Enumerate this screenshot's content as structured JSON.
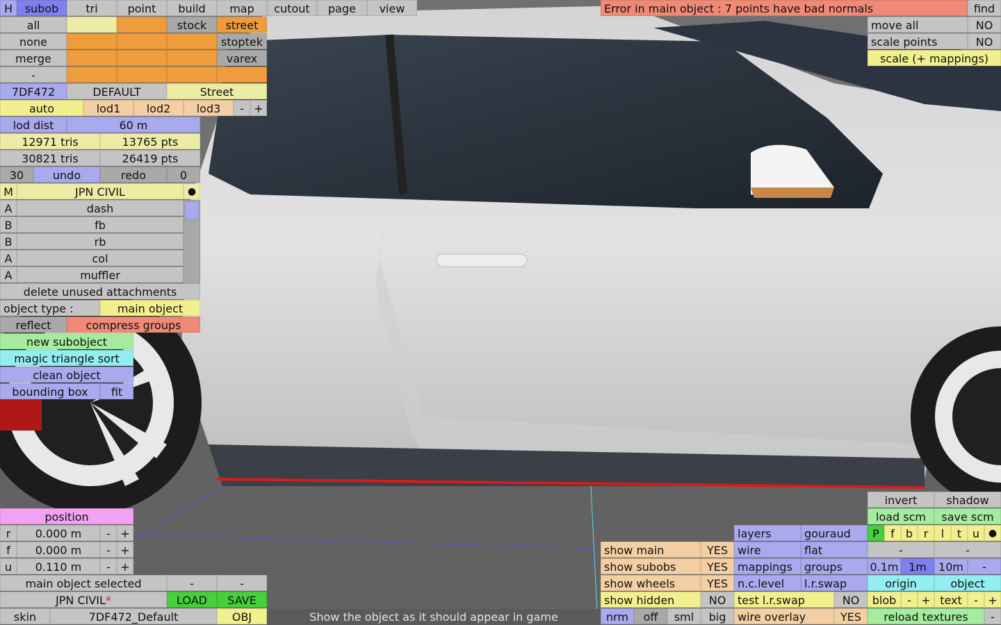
{
  "menu": {
    "h": "H",
    "items": [
      "subob",
      "tri",
      "point",
      "build",
      "map",
      "cutout",
      "page",
      "view"
    ]
  },
  "top_right": {
    "error": "Error in main object : 7 points have bad normals",
    "find": "find",
    "move_all": "move all",
    "move_all_val": "NO",
    "scale_points": "scale points",
    "scale_points_val": "NO",
    "scale_mappings": "scale (+ mappings)"
  },
  "sel": {
    "all": "all",
    "none": "none",
    "merge": "merge",
    "dash": "-"
  },
  "modes": {
    "stock": "stock",
    "street": "street",
    "stoptek": "stoptek",
    "varex": "varex"
  },
  "paint": {
    "code": "7DF472",
    "default": "DEFAULT",
    "street": "Street"
  },
  "lod": {
    "auto": "auto",
    "lod1": "lod1",
    "lod2": "lod2",
    "lod3": "lod3",
    "minus": "-",
    "plus": "+",
    "dist_label": "lod dist",
    "dist_value": "60 m"
  },
  "stats": {
    "tris1": "12971 tris",
    "pts1": "13765 pts",
    "tris2": "30821 tris",
    "pts2": "26419 pts"
  },
  "undo": {
    "count": "30",
    "undo": "undo",
    "redo": "redo",
    "redo_count": "0"
  },
  "model": {
    "m": "M",
    "name": "JPN CIVIL",
    "dot": "●"
  },
  "subobjects": [
    {
      "tag": "A",
      "name": "dash"
    },
    {
      "tag": "B",
      "name": "fb"
    },
    {
      "tag": "B",
      "name": "rb"
    },
    {
      "tag": "A",
      "name": "col"
    },
    {
      "tag": "A",
      "name": "muffler"
    }
  ],
  "actions": {
    "delete_unused": "delete unused attachments",
    "obj_type_label": "object type :",
    "obj_type_value": "main object",
    "reflect": "reflect",
    "compress": "compress groups",
    "new_sub": "new subobject",
    "magic": "magic triangle sort",
    "clean": "clean object",
    "bbox": "bounding box",
    "fit": "fit"
  },
  "position": {
    "title": "position",
    "rows": [
      {
        "axis": "r",
        "value": "0.000 m"
      },
      {
        "axis": "f",
        "value": "0.000 m"
      },
      {
        "axis": "u",
        "value": "0.110 m"
      }
    ],
    "minus": "-",
    "plus": "+"
  },
  "bottom_left": {
    "selected": "main object selected",
    "dash1": "-",
    "dash2": "-",
    "name": "JPN CIVIL",
    "star": "*",
    "load": "LOAD",
    "save": "SAVE",
    "skin": "skin",
    "skin_value": "7DF472_Default",
    "obj": "OBJ"
  },
  "status_text": "Show the object as it should appear in game",
  "show": [
    {
      "label": "show main",
      "value": "YES"
    },
    {
      "label": "show subobs",
      "value": "YES"
    },
    {
      "label": "show wheels",
      "value": "YES"
    },
    {
      "label": "show hidden",
      "value": "NO"
    }
  ],
  "norm": {
    "nrm": "nrm",
    "off": "off",
    "sml": "sml",
    "big": "big"
  },
  "render": {
    "layers": "layers",
    "gouraud": "gouraud",
    "wire": "wire",
    "flat": "flat",
    "mappings": "mappings",
    "groups": "groups",
    "nclevel": "n.c.level",
    "lrswap": "l.r.swap",
    "test_lrswap": "test l.r.swap",
    "test_lrswap_val": "NO",
    "wire_overlay": "wire overlay",
    "wire_overlay_val": "YES"
  },
  "right_tools": {
    "invert": "invert",
    "shadow": "shadow",
    "load_scm": "load scm",
    "save_scm": "save scm",
    "letters": [
      "P",
      "f",
      "b",
      "r",
      "l",
      "t",
      "u"
    ],
    "dot": "●",
    "dash1": "-",
    "dash2": "-",
    "step1": "0.1m",
    "step2": "1m",
    "step3": "10m",
    "step_minus": "-",
    "origin": "origin",
    "object": "object",
    "blob": "blob",
    "minus": "-",
    "plus": "+",
    "text": "text",
    "reload": "reload textures",
    "last": "-"
  }
}
